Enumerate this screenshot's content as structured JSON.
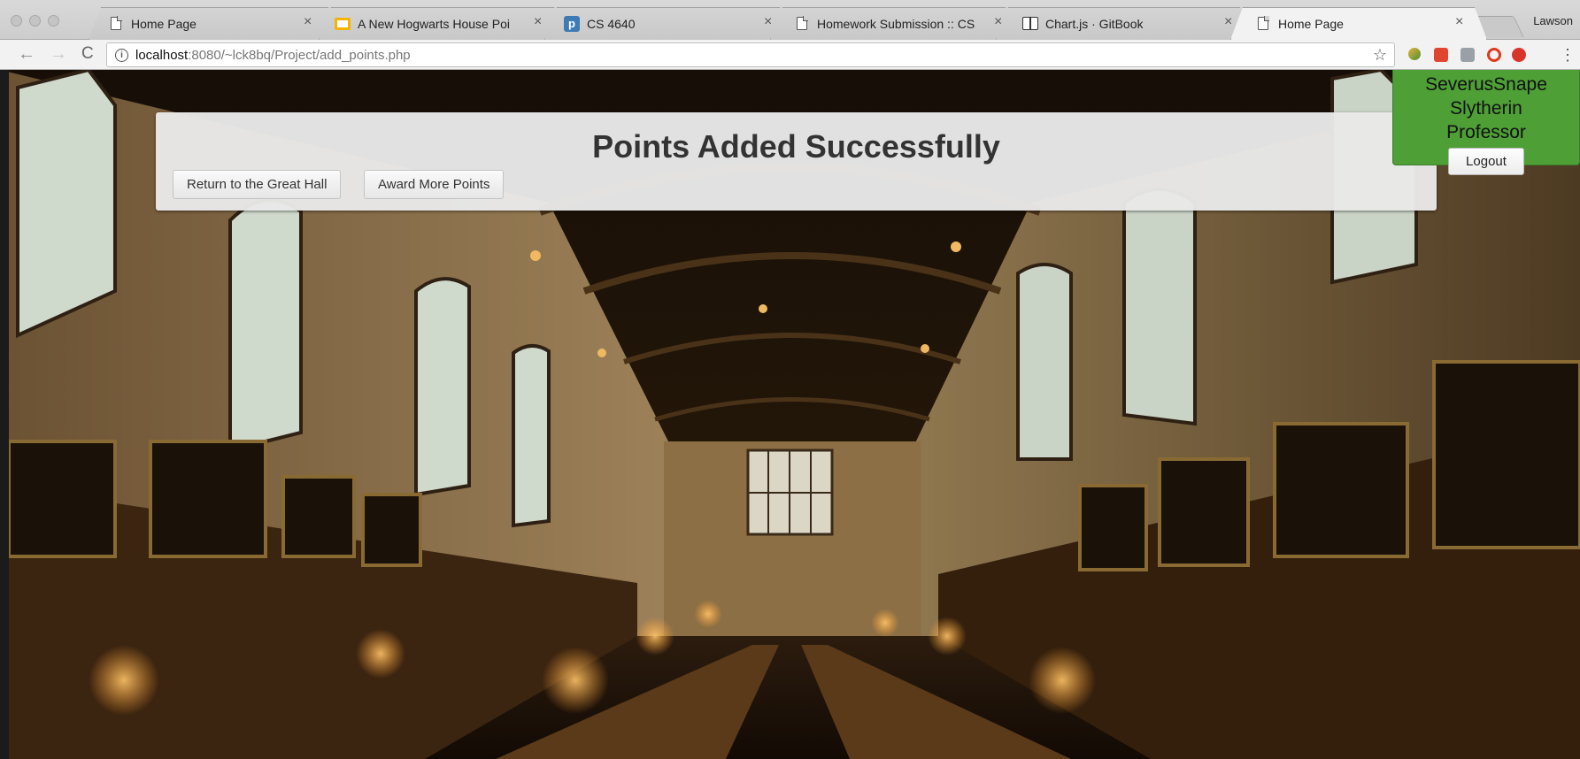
{
  "browser": {
    "tabs": [
      {
        "title": "Home Page",
        "icon": "page-icon",
        "active": false
      },
      {
        "title": "A New Hogwarts House Poi",
        "icon": "slides-icon",
        "active": false
      },
      {
        "title": "CS 4640",
        "icon": "p-icon",
        "icon_letter": "p",
        "active": false
      },
      {
        "title": "Homework Submission :: CS",
        "icon": "page-icon",
        "active": false
      },
      {
        "title": "Chart.js · GitBook",
        "icon": "book-icon",
        "active": false
      },
      {
        "title": "Home Page",
        "icon": "page-icon",
        "active": true
      }
    ],
    "close_glyph": "×",
    "profile_name": "Lawson",
    "url_host": "localhost",
    "url_path": ":8080/~lck8bq/Project/add_points.php",
    "info_glyph": "i",
    "back_glyph": "←",
    "forward_glyph": "→",
    "reload_glyph": "C",
    "star_glyph": "☆",
    "menu_glyph": "⋮"
  },
  "notice": {
    "heading": "Points Added Successfully",
    "return_label": "Return to the Great Hall",
    "award_label": "Award More Points"
  },
  "user": {
    "name": "SeverusSnape",
    "house": "Slytherin",
    "role": "Professor",
    "logout_label": "Logout",
    "house_color": "#4e9f36"
  }
}
